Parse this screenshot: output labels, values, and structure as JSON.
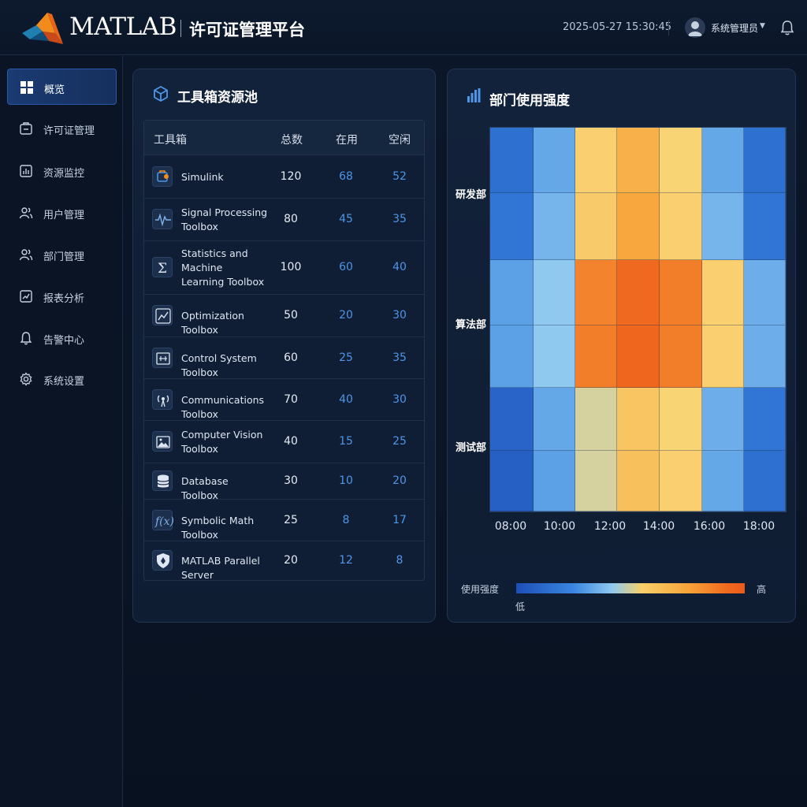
{
  "header": {
    "brand": "MATLAB",
    "platform_title": "许可证管理平台",
    "datetime": "2025-05-27 15:30:45",
    "username": "系统管理员"
  },
  "sidebar": {
    "items": [
      {
        "label": "概览",
        "icon": "grid-icon",
        "active": true
      },
      {
        "label": "许可证管理",
        "icon": "license-icon",
        "active": false
      },
      {
        "label": "资源监控",
        "icon": "monitor-chart-icon",
        "active": false
      },
      {
        "label": "用户管理",
        "icon": "users-icon",
        "active": false
      },
      {
        "label": "部门管理",
        "icon": "department-icon",
        "active": false
      },
      {
        "label": "报表分析",
        "icon": "report-icon",
        "active": false
      },
      {
        "label": "告警中心",
        "icon": "bell-icon",
        "active": false
      },
      {
        "label": "系统设置",
        "icon": "gear-icon",
        "active": false
      }
    ]
  },
  "toolbox_panel": {
    "title": "工具箱资源池",
    "columns": [
      "工具箱",
      "总数",
      "在用",
      "空闲"
    ],
    "rows": [
      {
        "name": "Simulink",
        "total": "120",
        "used": "68",
        "idle": "52",
        "icon": "simulink-icon"
      },
      {
        "name": "Signal Processing Toolbox",
        "total": "80",
        "used": "45",
        "idle": "35",
        "icon": "signal-wave-icon"
      },
      {
        "name": "Statistics and Machine Learning Toolbox",
        "total": "100",
        "used": "60",
        "idle": "40",
        "icon": "sigma-icon"
      },
      {
        "name": "Optimization Toolbox",
        "total": "50",
        "used": "20",
        "idle": "30",
        "icon": "optimization-chart-icon"
      },
      {
        "name": "Control System Toolbox",
        "total": "60",
        "used": "25",
        "idle": "35",
        "icon": "control-system-icon"
      },
      {
        "name": "Communications Toolbox",
        "total": "70",
        "used": "40",
        "idle": "30",
        "icon": "antenna-icon"
      },
      {
        "name": "Computer Vision Toolbox",
        "total": "40",
        "used": "15",
        "idle": "25",
        "icon": "image-icon"
      },
      {
        "name": "Database Toolbox",
        "total": "30",
        "used": "10",
        "idle": "20",
        "icon": "database-icon"
      },
      {
        "name": "Symbolic Math Toolbox",
        "total": "25",
        "used": "8",
        "idle": "17",
        "icon": "function-icon"
      },
      {
        "name": "MATLAB Parallel Server",
        "total": "20",
        "used": "12",
        "idle": "8",
        "icon": "shield-icon"
      }
    ]
  },
  "heatmap_panel": {
    "title": "部门使用强度",
    "legend_label": "使用强度",
    "legend_low": "低",
    "legend_high": "高"
  },
  "chart_data": {
    "type": "heatmap",
    "title": "部门使用强度",
    "y_categories": [
      "研发部",
      "算法部",
      "测试部"
    ],
    "x_tick_labels": [
      "08:00",
      "10:00",
      "12:00",
      "14:00",
      "16:00",
      "18:00"
    ],
    "columns": 7,
    "rows": 6,
    "intensity_scale": [
      0,
      1
    ],
    "values": [
      [
        0.12,
        0.3,
        0.58,
        0.7,
        0.56,
        0.3,
        0.12
      ],
      [
        0.14,
        0.34,
        0.6,
        0.74,
        0.58,
        0.34,
        0.14
      ],
      [
        0.28,
        0.4,
        0.86,
        0.95,
        0.88,
        0.58,
        0.32
      ],
      [
        0.28,
        0.4,
        0.88,
        0.96,
        0.88,
        0.58,
        0.32
      ],
      [
        0.08,
        0.3,
        0.5,
        0.62,
        0.56,
        0.32,
        0.14
      ],
      [
        0.06,
        0.28,
        0.5,
        0.64,
        0.58,
        0.3,
        0.12
      ]
    ],
    "colors": {
      "low": "#1d4fb8",
      "mid_low": "#8fc9f0",
      "mid": "#f9d06a",
      "high": "#ee5a1a"
    }
  }
}
